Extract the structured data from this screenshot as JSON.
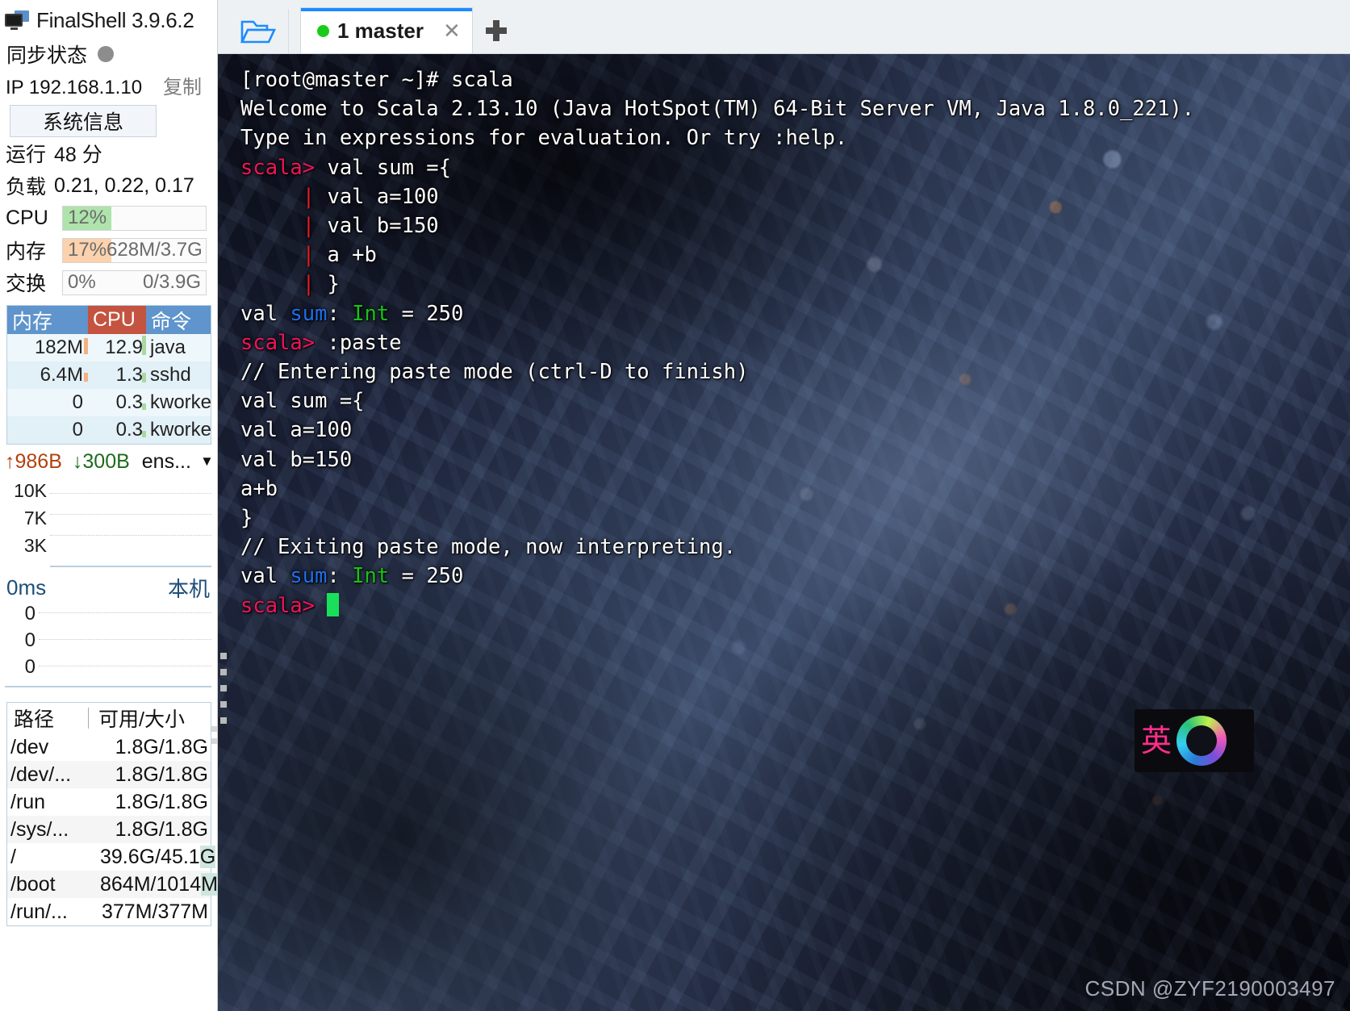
{
  "app": {
    "title": "FinalShell 3.9.6.2",
    "logo_icon": "monitor-icon"
  },
  "sidebar": {
    "sync": {
      "label": "同步状态",
      "status_icon": "status-dot-idle"
    },
    "ip": {
      "label": "IP 192.168.1.10",
      "copy_label": "复制"
    },
    "system_info_button": "系统信息",
    "uptime": {
      "label": "运行",
      "value": "48 分"
    },
    "load": {
      "label": "负载",
      "value": "0.21, 0.22, 0.17"
    },
    "cpu": {
      "label": "CPU",
      "percent": "12%",
      "percent_num": 12,
      "fill_color": "#aee3ab"
    },
    "memory": {
      "label": "内存",
      "percent": "17%",
      "percent_num": 17,
      "detail": "628M/3.7G",
      "fill_color": "#fbd2ad"
    },
    "swap": {
      "label": "交换",
      "percent": "0%",
      "percent_num": 0,
      "detail": "0/3.9G",
      "fill_color": "#fbd2ad"
    },
    "process_table": {
      "headers": {
        "mem": "内存",
        "cpu": "CPU",
        "cmd": "命令"
      },
      "rows": [
        {
          "mem": "182M",
          "cpu": "12.9",
          "cmd": "java",
          "mem_bar": 0.9,
          "cpu_bar": 1.0
        },
        {
          "mem": "6.4M",
          "cpu": "1.3",
          "cmd": "sshd",
          "mem_bar": 0.5,
          "cpu_bar": 0.5
        },
        {
          "mem": "0",
          "cpu": "0.3",
          "cmd": "kworker,",
          "mem_bar": 0.0,
          "cpu_bar": 0.35
        },
        {
          "mem": "0",
          "cpu": "0.3",
          "cmd": "kworker,",
          "mem_bar": 0.0,
          "cpu_bar": 0.35
        }
      ]
    },
    "network": {
      "upload": "986B",
      "download": "300B",
      "interface": "ens...",
      "up_icon": "arrow-up-icon",
      "down_icon": "arrow-down-icon",
      "dropdown_icon": "chevron-down-icon",
      "y_labels": [
        "10K",
        "7K",
        "3K"
      ]
    },
    "ping": {
      "latency": "0ms",
      "target": "本机",
      "y_labels": [
        "0",
        "0",
        "0"
      ]
    },
    "disk_table": {
      "headers": {
        "path": "路径",
        "size": "可用/大小"
      },
      "rows": [
        {
          "path": "/dev",
          "size": "1.8G/1.8G",
          "highlight": ""
        },
        {
          "path": "/dev/...",
          "size": "1.8G/1.8G",
          "highlight": ""
        },
        {
          "path": "/run",
          "size": "1.8G/1.8G",
          "highlight": ""
        },
        {
          "path": "/sys/...",
          "size": "1.8G/1.8G",
          "highlight": ""
        },
        {
          "path": "/",
          "size": "39.6G/45.1G",
          "highlight": "G"
        },
        {
          "path": "/boot",
          "size": "864M/1014M",
          "highlight": "M"
        },
        {
          "path": "/run/...",
          "size": "377M/377M",
          "highlight": ""
        }
      ]
    }
  },
  "tabbar": {
    "folder_icon": "open-folder-icon",
    "add_icon": "plus-icon",
    "tabs": [
      {
        "label": "1 master",
        "status_icon": "connected-dot",
        "close_icon": "close-icon",
        "active": true
      }
    ]
  },
  "terminal": {
    "cursor_icon": "block-cursor",
    "lines": [
      {
        "segments": [
          {
            "t": "[root@master ~]# scala",
            "c": "white"
          }
        ]
      },
      {
        "segments": [
          {
            "t": "Welcome to Scala 2.13.10 (Java HotSpot(TM) 64-Bit Server VM, Java 1.8.0_221).",
            "c": "white"
          }
        ]
      },
      {
        "segments": [
          {
            "t": "Type in expressions for evaluation. Or try :help.",
            "c": "white"
          }
        ]
      },
      {
        "segments": [
          {
            "t": "",
            "c": "white"
          }
        ]
      },
      {
        "segments": [
          {
            "t": "scala>",
            "c": "prompt"
          },
          {
            "t": " val sum ={",
            "c": "white"
          }
        ]
      },
      {
        "segments": [
          {
            "t": "     |",
            "c": "pipe"
          },
          {
            "t": " val a=100",
            "c": "white"
          }
        ]
      },
      {
        "segments": [
          {
            "t": "     |",
            "c": "pipe"
          },
          {
            "t": " val b=150",
            "c": "white"
          }
        ]
      },
      {
        "segments": [
          {
            "t": "     |",
            "c": "pipe"
          },
          {
            "t": " a +b",
            "c": "white"
          }
        ]
      },
      {
        "segments": [
          {
            "t": "     |",
            "c": "pipe"
          },
          {
            "t": " }",
            "c": "white"
          }
        ]
      },
      {
        "segments": [
          {
            "t": "val ",
            "c": "white"
          },
          {
            "t": "sum",
            "c": "blue"
          },
          {
            "t": ": ",
            "c": "white"
          },
          {
            "t": "Int",
            "c": "green"
          },
          {
            "t": " = 250",
            "c": "white"
          }
        ]
      },
      {
        "segments": [
          {
            "t": "",
            "c": "white"
          }
        ]
      },
      {
        "segments": [
          {
            "t": "scala>",
            "c": "prompt"
          },
          {
            "t": " :paste",
            "c": "white"
          }
        ]
      },
      {
        "segments": [
          {
            "t": "// Entering paste mode (ctrl-D to finish)",
            "c": "white"
          }
        ]
      },
      {
        "segments": [
          {
            "t": "",
            "c": "white"
          }
        ]
      },
      {
        "segments": [
          {
            "t": "val sum ={",
            "c": "white"
          }
        ]
      },
      {
        "segments": [
          {
            "t": "val a=100",
            "c": "white"
          }
        ]
      },
      {
        "segments": [
          {
            "t": "val b=150",
            "c": "white"
          }
        ]
      },
      {
        "segments": [
          {
            "t": "a+b",
            "c": "white"
          }
        ]
      },
      {
        "segments": [
          {
            "t": "}",
            "c": "white"
          }
        ]
      },
      {
        "segments": [
          {
            "t": "",
            "c": "white"
          }
        ]
      },
      {
        "segments": [
          {
            "t": "",
            "c": "white"
          }
        ]
      },
      {
        "segments": [
          {
            "t": "// Exiting paste mode, now interpreting.",
            "c": "white"
          }
        ]
      },
      {
        "segments": [
          {
            "t": "",
            "c": "white"
          }
        ]
      },
      {
        "segments": [
          {
            "t": "val ",
            "c": "white"
          },
          {
            "t": "sum",
            "c": "blue"
          },
          {
            "t": ": ",
            "c": "white"
          },
          {
            "t": "Int",
            "c": "green"
          },
          {
            "t": " = 250",
            "c": "white"
          }
        ]
      },
      {
        "segments": [
          {
            "t": "",
            "c": "white"
          }
        ]
      },
      {
        "segments": [
          {
            "t": "scala>",
            "c": "prompt"
          },
          {
            "t": " ",
            "c": "white"
          },
          {
            "t": "",
            "c": "cursor"
          }
        ]
      }
    ]
  },
  "ime_widget": {
    "char": "英",
    "ring_icon": "color-ring-icon"
  },
  "watermark": "CSDN @ZYF2190003497"
}
